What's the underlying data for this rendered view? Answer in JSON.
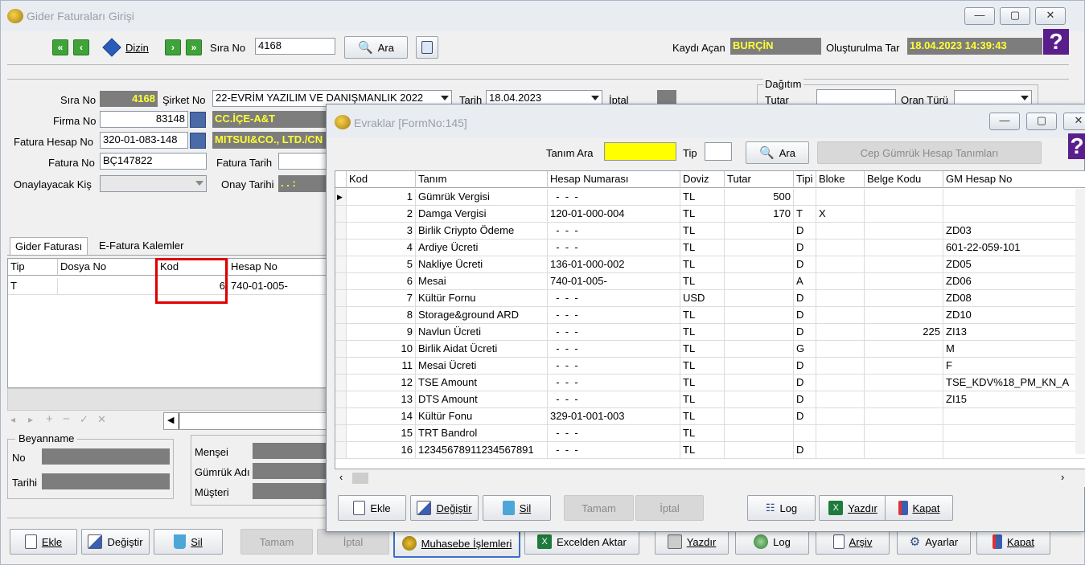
{
  "main_window": {
    "title": "Gider Faturaları Girişi",
    "controls": {
      "minimize": "—",
      "maximize": "▢",
      "close": "✕"
    },
    "toolbar": {
      "dizin": "Dizin",
      "sira_no_label": "Sıra No",
      "sira_no_value": "4168",
      "ara": "Ara",
      "kaydi_acan_label": "Kaydı Açan",
      "kaydi_acan_value": "BURÇİN",
      "olusturulma_label": "Oluşturulma Tar",
      "olusturulma_value": "18.04.2023 14:39:43",
      "help": "?"
    },
    "form": {
      "sira_no_label": "Sıra No",
      "sira_no_value": "4168",
      "sirket_no_label": "Şirket No",
      "sirket_no_value": "22-EVRİM YAZILIM  VE DANIŞMANLIK 2022",
      "tarih_label": "Tarih",
      "tarih_value": "18.04.2023",
      "iptal_label": "İptal",
      "firma_no_label": "Firma No",
      "firma_no_value": "83148",
      "firma_name": "CC.İÇE-A&T",
      "fatura_hesap_label": "Fatura Hesap No",
      "fatura_hesap_value": "320-01-083-148",
      "fatura_hesap_name": "MITSUI&CO., LTD./CN",
      "fatura_no_label": "Fatura No",
      "fatura_no_value": "BÇ147822",
      "fatura_tarih_label": "Fatura Tarih",
      "onaylayacak_label": "Onaylayacak Kiş",
      "onay_tarihi_label": "Onay Tarihi",
      "onay_tarihi_value": ". .    :",
      "dagitim_label": "Dağıtım",
      "tutar_label": "Tutar",
      "oran_turu_label": "Oran Türü"
    },
    "tabs": [
      "Gider Faturası",
      "E-Fatura Kalemler"
    ],
    "grid": {
      "headers": [
        "Tip",
        "Dosya No",
        "Kod",
        "Hesap No"
      ],
      "rows": [
        [
          "T",
          "",
          "6",
          "740-01-005-"
        ]
      ]
    },
    "beyanname": {
      "group_label": "Beyanname",
      "no_label": "No",
      "tarihi_label": "Tarihi",
      "mensei_label": "Menşei",
      "gumruk_label": "Gümrük Adı",
      "musteri_label": "Müşteri"
    },
    "bottom_buttons": {
      "ekle": "Ekle",
      "degistir": "Değiştir",
      "sil": "Sil",
      "tamam": "Tamam",
      "iptal": "İptal",
      "muhasebe": "Muhasebe İşlemleri",
      "excel": "Excelden Aktar",
      "yazdir": "Yazdır",
      "log": "Log",
      "arsiv": "Arşiv",
      "ayarlar": "Ayarlar",
      "kapat": "Kapat"
    }
  },
  "child_window": {
    "title": "Evraklar [FormNo:145]",
    "controls": {
      "minimize": "—",
      "maximize": "▢",
      "close": "✕"
    },
    "search": {
      "tanim_ara_label": "Tanım Ara",
      "tip_label": "Tip",
      "ara": "Ara",
      "cep_gumruk": "Cep Gümrük Hesap Tanımları",
      "help": "?"
    },
    "grid": {
      "headers": [
        "Kod",
        "Tanım",
        "Hesap Numarası",
        "Doviz",
        "Tutar",
        "Tipi",
        "Bloke",
        "Belge Kodu",
        "GM Hesap No"
      ],
      "rows": [
        [
          "1",
          "Gümrük Vergisi",
          "  -  -  -",
          "TL",
          "500",
          "",
          "",
          "",
          ""
        ],
        [
          "2",
          "Damga Vergisi",
          "120-01-000-004",
          "TL",
          "170",
          "T",
          "X",
          "",
          ""
        ],
        [
          "3",
          "Birlik Criypto Ödeme",
          "  -  -  -",
          "TL",
          "",
          "D",
          "",
          "",
          "ZD03"
        ],
        [
          "4",
          "Ardiye Ücreti",
          "  -  -  -",
          "TL",
          "",
          "D",
          "",
          "",
          "601-22-059-101"
        ],
        [
          "5",
          "Nakliye Ücreti",
          "136-01-000-002",
          "TL",
          "",
          "D",
          "",
          "",
          "ZD05"
        ],
        [
          "6",
          "Mesai",
          "740-01-005-",
          "TL",
          "",
          "A",
          "",
          "",
          "ZD06"
        ],
        [
          "7",
          "Kültür Fornu",
          "  -  -  -",
          "USD",
          "",
          "D",
          "",
          "",
          "ZD08"
        ],
        [
          "8",
          "Storage&ground ARD",
          "  -  -  -",
          "TL",
          "",
          "D",
          "",
          "",
          "ZD10"
        ],
        [
          "9",
          "Navlun Ücreti",
          "  -  -  -",
          "TL",
          "",
          "D",
          "",
          "225",
          "ZI13"
        ],
        [
          "10",
          "Birlik Aidat Ücreti",
          "  -  -  -",
          "TL",
          "",
          "G",
          "",
          "",
          "M"
        ],
        [
          "11",
          "Mesai Ücreti",
          "  -  -  -",
          "TL",
          "",
          "D",
          "",
          "",
          "F"
        ],
        [
          "12",
          "TSE Amount",
          "  -  -  -",
          "TL",
          "",
          "D",
          "",
          "",
          "TSE_KDV%18_PM_KN_A"
        ],
        [
          "13",
          "DTS Amount",
          "  -  -  -",
          "TL",
          "",
          "D",
          "",
          "",
          "ZI15"
        ],
        [
          "14",
          "Kültür Fonu",
          "329-01-001-003",
          "TL",
          "",
          "D",
          "",
          "",
          ""
        ],
        [
          "15",
          "TRT Bandrol",
          "  -  -  -",
          "TL",
          "",
          "",
          "",
          "",
          ""
        ],
        [
          "16",
          "12345678911234567891",
          "  -  -  -",
          "TL",
          "",
          "D",
          "",
          "",
          ""
        ]
      ]
    },
    "buttons": {
      "ekle": "Ekle",
      "degistir": "Değiştir",
      "sil": "Sil",
      "tamam": "Tamam",
      "iptal": "İptal",
      "log": "Log",
      "yazdir": "Yazdır",
      "kapat": "Kapat"
    }
  },
  "colors": {
    "highlight": "#ffff00",
    "gray_field": "#7d7d7d",
    "red_box": "#e00000",
    "nav_green": "#3fa33a"
  }
}
